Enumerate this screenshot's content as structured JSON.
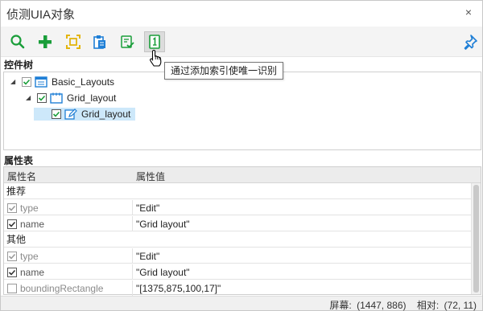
{
  "window": {
    "title": "侦测UIA对象",
    "close_glyph": "×"
  },
  "toolbar": {
    "buttons": [
      {
        "name": "search-icon"
      },
      {
        "name": "plus-icon"
      },
      {
        "name": "capture-icon"
      },
      {
        "name": "clipboard-icon"
      },
      {
        "name": "validate-icon"
      },
      {
        "name": "index-icon"
      }
    ],
    "pin_icon": "pin-icon",
    "tooltip": "通过添加索引使唯一识别"
  },
  "tree": {
    "label": "控件树",
    "nodes": [
      {
        "label": "Basic_Layouts",
        "level": 0,
        "expanded": true,
        "checked": true,
        "checkbox_style": "gray",
        "icon": "window-icon"
      },
      {
        "label": "Grid_layout",
        "level": 1,
        "expanded": true,
        "checked": true,
        "checkbox_style": "dark",
        "icon": "grid-icon"
      },
      {
        "label": "Grid_layout",
        "level": 2,
        "expanded": false,
        "checked": true,
        "checkbox_style": "dark",
        "icon": "edit-icon",
        "selected": true
      }
    ]
  },
  "properties": {
    "label": "属性表",
    "columns": [
      "属性名",
      "属性值"
    ],
    "groups": [
      {
        "name": "推荐",
        "rows": [
          {
            "name": "type",
            "value": "\"Edit\"",
            "checked": true,
            "locked": true
          },
          {
            "name": "name",
            "value": "\"Grid layout\"",
            "checked": true,
            "locked": false
          }
        ]
      },
      {
        "name": "其他",
        "rows": [
          {
            "name": "type",
            "value": "\"Edit\"",
            "checked": true,
            "locked": true
          },
          {
            "name": "name",
            "value": "\"Grid layout\"",
            "checked": true,
            "locked": false
          },
          {
            "name": "boundingRectangle",
            "value": "\"[1375,875,100,17]\"",
            "checked": false,
            "locked": true
          }
        ]
      }
    ]
  },
  "status": {
    "screen_label": "屏幕:",
    "screen_value": "(1447, 886)",
    "relative_label": "相对:",
    "relative_value": "(72, 11)"
  },
  "colors": {
    "accent_blue": "#1f7fd6",
    "green": "#1a9e3a",
    "selection": "#cde8fa",
    "yellow": "#e3b50d"
  }
}
